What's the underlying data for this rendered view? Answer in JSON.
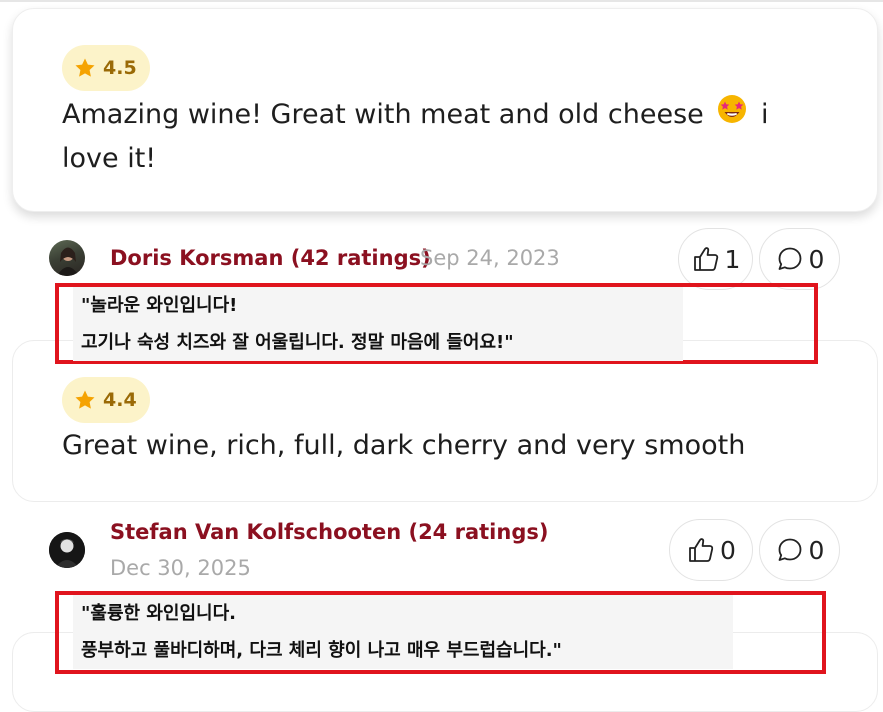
{
  "reviews": [
    {
      "rating": "4.5",
      "text": "Amazing wine! Great with meat and old cheese",
      "text_tail": "i love it!",
      "emoji": "star-struck-emoji"
    },
    {
      "rating": "4.4",
      "text": "Great wine, rich, full, dark cherry and very smooth"
    }
  ],
  "meta": [
    {
      "user": "Doris Korsman (42 ratings)",
      "date": "Sep 24, 2023",
      "likes": "1",
      "comments": "0",
      "translation": [
        "\"놀라운 와인입니다!",
        "고기나 숙성 치즈와 잘 어울립니다. 정말 마음에 들어요!\""
      ]
    },
    {
      "user": "Stefan Van Kolfschooten (24 ratings)",
      "date": "Dec 30, 2025",
      "likes": "0",
      "comments": "0",
      "translation": [
        "\"훌륭한 와인입니다.",
        "풍부하고 풀바디하며, 다크 체리 향이 나고 매우 부드럽습니다.\""
      ]
    }
  ],
  "colors": {
    "username": "#8b1020",
    "rating_bg": "#fcf3c9",
    "rating_text": "#9a6a06",
    "star": "#f5a302",
    "highlight_border": "#e0141d"
  },
  "icons": [
    "star-icon",
    "thumbs-up-icon",
    "comment-icon"
  ]
}
